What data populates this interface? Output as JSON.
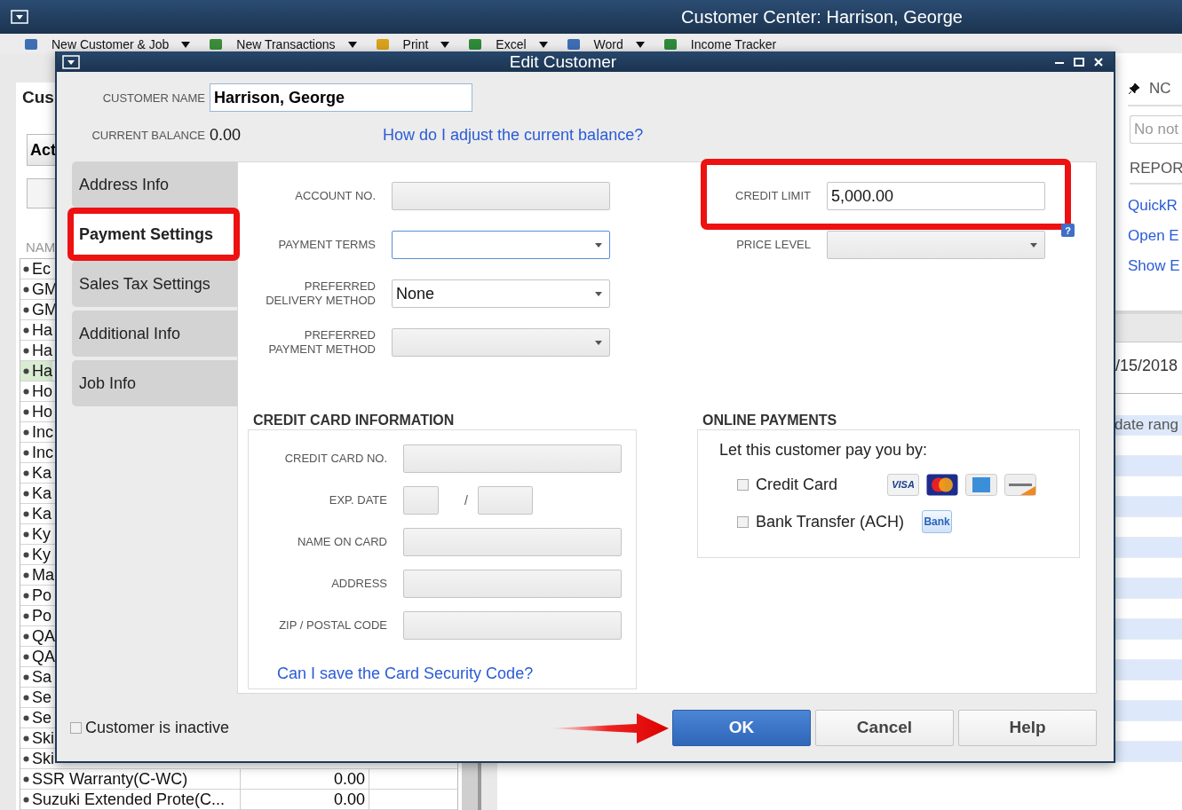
{
  "app": {
    "title": "Customer Center: Harrison, George"
  },
  "toolbar": [
    {
      "label": "New Customer & Job",
      "dropdown": true
    },
    {
      "label": "New Transactions",
      "dropdown": true
    },
    {
      "label": "Print",
      "dropdown": true
    },
    {
      "label": "Excel",
      "dropdown": true
    },
    {
      "label": "Word",
      "dropdown": true
    },
    {
      "label": "Income Tracker",
      "dropdown": false
    }
  ],
  "customers_panel": {
    "title": "Cus",
    "view_select": "Act",
    "name_header": "NAM",
    "rows": [
      {
        "name": "Ec",
        "selected": false
      },
      {
        "name": "GM",
        "selected": false
      },
      {
        "name": "GM",
        "selected": false
      },
      {
        "name": "Ha",
        "selected": false
      },
      {
        "name": "Ha",
        "selected": false
      },
      {
        "name": "Ha",
        "selected": true
      },
      {
        "name": "Ho",
        "selected": false
      },
      {
        "name": "Ho",
        "selected": false
      },
      {
        "name": "Inc",
        "selected": false
      },
      {
        "name": "Inc",
        "selected": false
      },
      {
        "name": "Ka",
        "selected": false
      },
      {
        "name": "Ka",
        "selected": false
      },
      {
        "name": "Ka",
        "selected": false
      },
      {
        "name": "Ky",
        "selected": false
      },
      {
        "name": "Ky",
        "selected": false
      },
      {
        "name": "Ma",
        "selected": false
      },
      {
        "name": "Po",
        "selected": false
      },
      {
        "name": "Po",
        "selected": false
      },
      {
        "name": "QA",
        "selected": false
      },
      {
        "name": "QA",
        "selected": false
      },
      {
        "name": "Sa",
        "selected": false
      },
      {
        "name": "Se",
        "selected": false
      },
      {
        "name": "Se",
        "selected": false
      },
      {
        "name": "Ski",
        "selected": false
      },
      {
        "name": "Ski",
        "selected": false
      },
      {
        "name": "SSR Warranty(C-WC)",
        "balance": "0.00",
        "selected": false
      },
      {
        "name": "Suzuki Extended Prote(C...",
        "balance": "0.00",
        "selected": false
      }
    ]
  },
  "notes_panel": {
    "notes_heading": "NC",
    "notes_placeholder": "No not",
    "reports_heading": "REPOR",
    "links": [
      "QuickR",
      "Open E",
      "Show E"
    ]
  },
  "transactions": {
    "date": "/15/2018",
    "column_header": "date rang"
  },
  "dialog": {
    "title": "Edit Customer",
    "customer_name_label": "CUSTOMER NAME",
    "customer_name": "Harrison, George",
    "balance_label": "CURRENT BALANCE",
    "balance": "0.00",
    "balance_link": "How do I adjust the current balance?",
    "tabs": [
      {
        "label": "Address Info",
        "selected": false,
        "highlight": false
      },
      {
        "label": "Payment Settings",
        "selected": true,
        "highlight": true
      },
      {
        "label": "Sales Tax Settings",
        "selected": false,
        "highlight": false
      },
      {
        "label": "Additional Info",
        "selected": false,
        "highlight": false
      },
      {
        "label": "Job Info",
        "selected": false,
        "highlight": false
      }
    ],
    "fields": [
      {
        "label": "ACCOUNT NO.",
        "kind": "text",
        "focused": false
      },
      {
        "label": "PAYMENT TERMS",
        "kind": "select",
        "focused": true
      },
      {
        "label": "PREFERRED DELIVERY METHOD",
        "kind": "select",
        "value": "None",
        "focused": false
      },
      {
        "label": "PREFERRED PAYMENT METHOD",
        "kind": "select",
        "focused": false
      }
    ],
    "right_fields": [
      {
        "label": "CREDIT LIMIT",
        "kind": "text",
        "value": "5,000.00",
        "highlight": true
      },
      {
        "label": "PRICE LEVEL",
        "kind": "select",
        "highlight": false,
        "help": "?"
      }
    ],
    "credit_card": {
      "title": "CREDIT CARD INFORMATION",
      "fields": [
        {
          "label": "CREDIT CARD NO.",
          "kind": "text"
        },
        {
          "label": "EXP. DATE",
          "kind": "date",
          "separator": "/"
        },
        {
          "label": "NAME ON CARD",
          "kind": "text"
        },
        {
          "label": "ADDRESS",
          "kind": "text"
        },
        {
          "label": "ZIP / POSTAL CODE",
          "kind": "text"
        }
      ],
      "link": "Can I save the Card Security Code?"
    },
    "online_payments": {
      "title": "ONLINE PAYMENTS",
      "prompt": "Let this customer pay you by:",
      "options": [
        {
          "label": "Credit Card",
          "checked": false,
          "kind": "cards",
          "logo_text": "VISA"
        },
        {
          "label": "Bank Transfer (ACH)",
          "checked": false,
          "kind": "bank",
          "logo_text": "Bank"
        }
      ]
    },
    "inactive": {
      "label": "Customer is inactive",
      "checked": false
    },
    "buttons": [
      {
        "label": "OK",
        "primary": true,
        "pointed": true
      },
      {
        "label": "Cancel",
        "primary": false,
        "pointed": false
      },
      {
        "label": "Help",
        "primary": false,
        "pointed": false
      }
    ]
  }
}
